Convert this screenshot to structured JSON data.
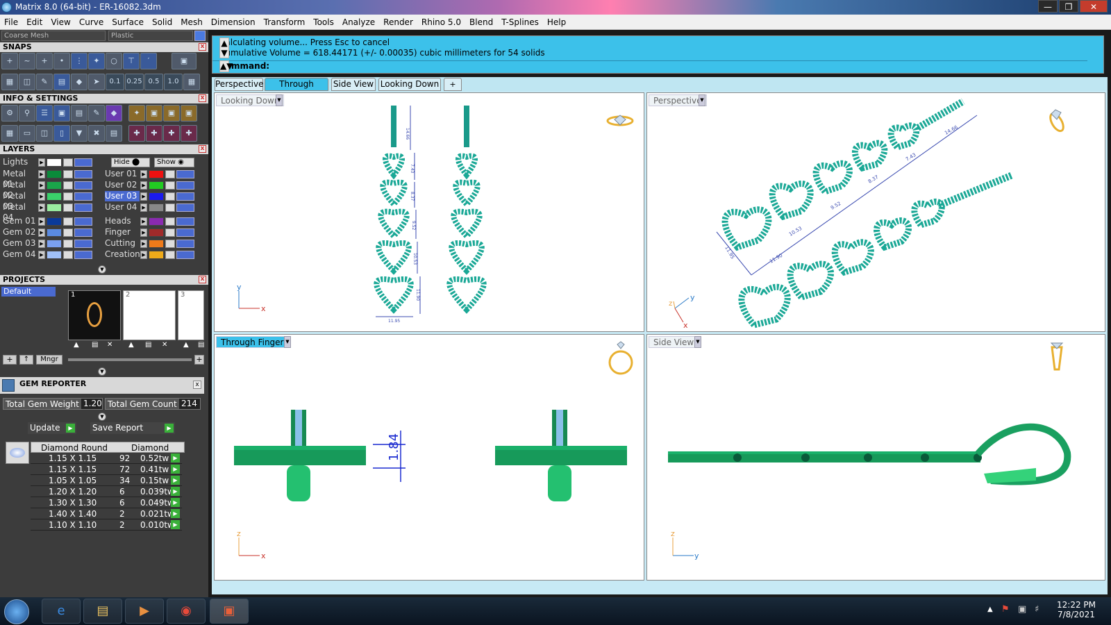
{
  "window": {
    "title": "Matrix 8.0 (64-bit) - ER-16082.3dm"
  },
  "menu": [
    "File",
    "Edit",
    "View",
    "Curve",
    "Surface",
    "Solid",
    "Mesh",
    "Dimension",
    "Transform",
    "Tools",
    "Analyze",
    "Render",
    "Rhino 5.0",
    "Blend",
    "T-Splines",
    "Help"
  ],
  "toolbar": {
    "mesh_dropdown": "Coarse Mesh",
    "material_dropdown": "Plastic"
  },
  "snaps": {
    "header": "SNAPS",
    "grid_values": [
      "0.1",
      "0.25",
      "0.5",
      "1.0"
    ]
  },
  "info": {
    "header": "INFO & SETTINGS"
  },
  "layers": {
    "header": "LAYERS",
    "lights_label": "Lights",
    "hide_label": "Hide",
    "show_label": "Show",
    "left": [
      {
        "name": "Metal 01",
        "color": "#0a8a3a"
      },
      {
        "name": "Metal 02",
        "color": "#1aa54a"
      },
      {
        "name": "Metal 03",
        "color": "#3ad06a"
      },
      {
        "name": "Metal 04",
        "color": "#9aeea0"
      },
      {
        "name": "Gem 01",
        "color": "#0a3a9a"
      },
      {
        "name": "Gem 02",
        "color": "#5a8ae0"
      },
      {
        "name": "Gem 03",
        "color": "#7aa0f0"
      },
      {
        "name": "Gem 04",
        "color": "#a0c0f8"
      }
    ],
    "right": [
      {
        "name": "User 01",
        "color": "#ee1111"
      },
      {
        "name": "User 02",
        "color": "#22cc22"
      },
      {
        "name": "User 03",
        "color": "#1a1aee"
      },
      {
        "name": "User 04",
        "color": "#888888"
      },
      {
        "name": "Heads",
        "color": "#8a2ab0"
      },
      {
        "name": "Finger",
        "color": "#a02a2a"
      },
      {
        "name": "Cutting",
        "color": "#ee7a1a"
      },
      {
        "name": "Creation",
        "color": "#eeaa1a"
      }
    ]
  },
  "projects": {
    "header": "PROJECTS",
    "default_label": "Default",
    "thumbs": [
      "1",
      "2",
      "3"
    ],
    "mngr_label": "Mngr"
  },
  "gem_reporter": {
    "header": "GEM REPORTER",
    "total_weight_label": "Total Gem Weight",
    "total_weight": "1.20",
    "total_count_label": "Total Gem Count",
    "total_count": "214",
    "update_label": "Update",
    "save_report_label": "Save Report",
    "col1": "Diamond Round",
    "col2": "Diamond",
    "rows": [
      {
        "size": "1.15 X 1.15",
        "count": "92",
        "weight": "0.52tw"
      },
      {
        "size": "1.15 X 1.15",
        "count": "72",
        "weight": "0.41tw"
      },
      {
        "size": "1.05 X 1.05",
        "count": "34",
        "weight": "0.15tw"
      },
      {
        "size": "1.20 X 1.20",
        "count": "6",
        "weight": "0.039tw"
      },
      {
        "size": "1.30 X 1.30",
        "count": "6",
        "weight": "0.049tw"
      },
      {
        "size": "1.40 X 1.40",
        "count": "2",
        "weight": "0.021tw"
      },
      {
        "size": "1.10 X 1.10",
        "count": "2",
        "weight": "0.010tw"
      }
    ]
  },
  "command": {
    "line1": "Calculating volume... Press Esc to cancel",
    "line2": "Cumulative Volume = 618.44171 (+/- 0.00035) cubic millimeters for 54 solids",
    "prompt": "Command:"
  },
  "tabs": [
    "Perspective",
    "Through Finger",
    "Side View",
    "Looking Down"
  ],
  "viewports": {
    "top_left": {
      "label": "Looking Down",
      "axis_a": "y",
      "axis_b": "x",
      "dims": [
        "14.66",
        "7.43",
        "8.37",
        "9.52",
        "10.53",
        "11.90",
        "11.95"
      ]
    },
    "top_right": {
      "label": "Perspective",
      "axis_a": "z",
      "axis_b": "y",
      "axis_c": "x",
      "dims": [
        "14.66",
        "7.43",
        "8.37",
        "9.52",
        "10.53",
        "11.90",
        "11.95"
      ]
    },
    "bottom_left": {
      "label": "Through Finger",
      "axis_a": "z",
      "axis_b": "x",
      "dim": "1.84"
    },
    "bottom_right": {
      "label": "Side View",
      "axis_a": "z",
      "axis_b": "y"
    }
  },
  "clock": {
    "time": "12:22 PM",
    "date": "7/8/2021"
  }
}
